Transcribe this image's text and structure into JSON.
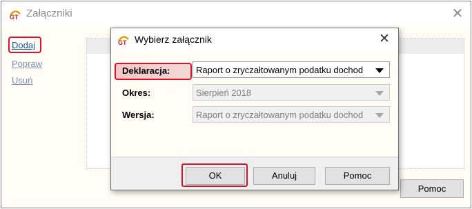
{
  "outer_window": {
    "title": "Załączniki",
    "sidebar": {
      "add_label": "Dodaj",
      "edit_label": "Popraw",
      "remove_label": "Usuń"
    },
    "help_label": "Pomoc"
  },
  "dialog": {
    "title": "Wybierz załącznik",
    "fields": {
      "declaration_label": "Deklaracja:",
      "declaration_value": "Raport o zryczałtowanym podatku dochod",
      "period_label": "Okres:",
      "period_value": "Sierpień 2018",
      "version_label": "Wersja:",
      "version_value": "Raport o zryczałtowanym podatku dochod"
    },
    "buttons": {
      "ok_label": "OK",
      "cancel_label": "Anuluj",
      "help_label": "Pomoc"
    }
  },
  "colors": {
    "highlight": "#e0102a",
    "link": "#1a56a8"
  },
  "icons": {
    "app_logo": "gt-logo-icon",
    "close": "close-icon",
    "dropdown": "chevron-down-icon"
  }
}
